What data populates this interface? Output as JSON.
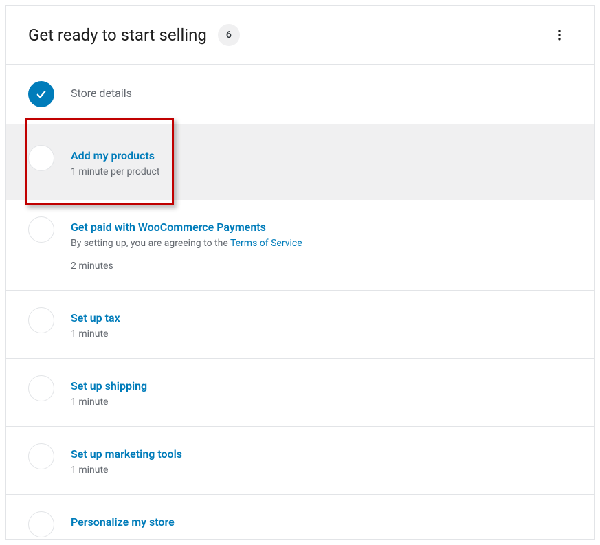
{
  "header": {
    "title": "Get ready to start selling",
    "count": "6"
  },
  "tasks": [
    {
      "title": "Store details",
      "completed": true
    },
    {
      "title": "Add my products",
      "subtitle": "1 minute per product",
      "highlighted": true
    },
    {
      "title": "Get paid with WooCommerce Payments",
      "subtitle_prefix": "By setting up, you are agreeing to the ",
      "link_text": "Terms of Service",
      "duration": "2 minutes"
    },
    {
      "title": "Set up tax",
      "duration": "1 minute"
    },
    {
      "title": "Set up shipping",
      "duration": "1 minute"
    },
    {
      "title": "Set up marketing tools",
      "duration": "1 minute"
    },
    {
      "title": "Personalize my store"
    }
  ]
}
